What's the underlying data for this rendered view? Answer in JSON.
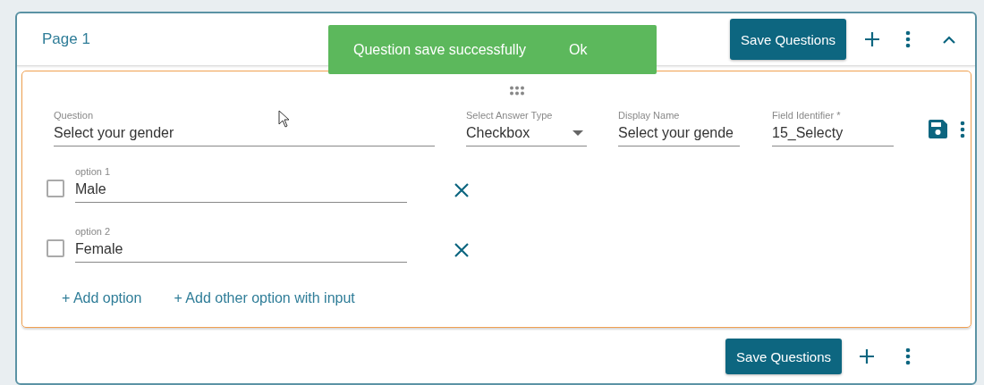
{
  "page": {
    "title": "Page 1"
  },
  "header_actions": {
    "save_button": "Save Questions"
  },
  "toast": {
    "message": "Question save successfully",
    "action": "Ok"
  },
  "question": {
    "fields": [
      {
        "kind": "text",
        "label": "Question",
        "value": "Select your gender"
      },
      {
        "kind": "select",
        "label": "Select Answer Type",
        "value": "Checkbox"
      },
      {
        "kind": "text",
        "label": "Display Name",
        "value": "Select your gende"
      },
      {
        "kind": "text",
        "label": "Field Identifier *",
        "value": "15_Selecty"
      }
    ],
    "options": [
      {
        "label": "option 1",
        "value": "Male",
        "checked": false
      },
      {
        "label": "option 2",
        "value": "Female",
        "checked": false
      }
    ],
    "links": [
      "+ Add option",
      "+ Add other option with input"
    ]
  },
  "footer_actions": {
    "save_button": "Save Questions"
  }
}
